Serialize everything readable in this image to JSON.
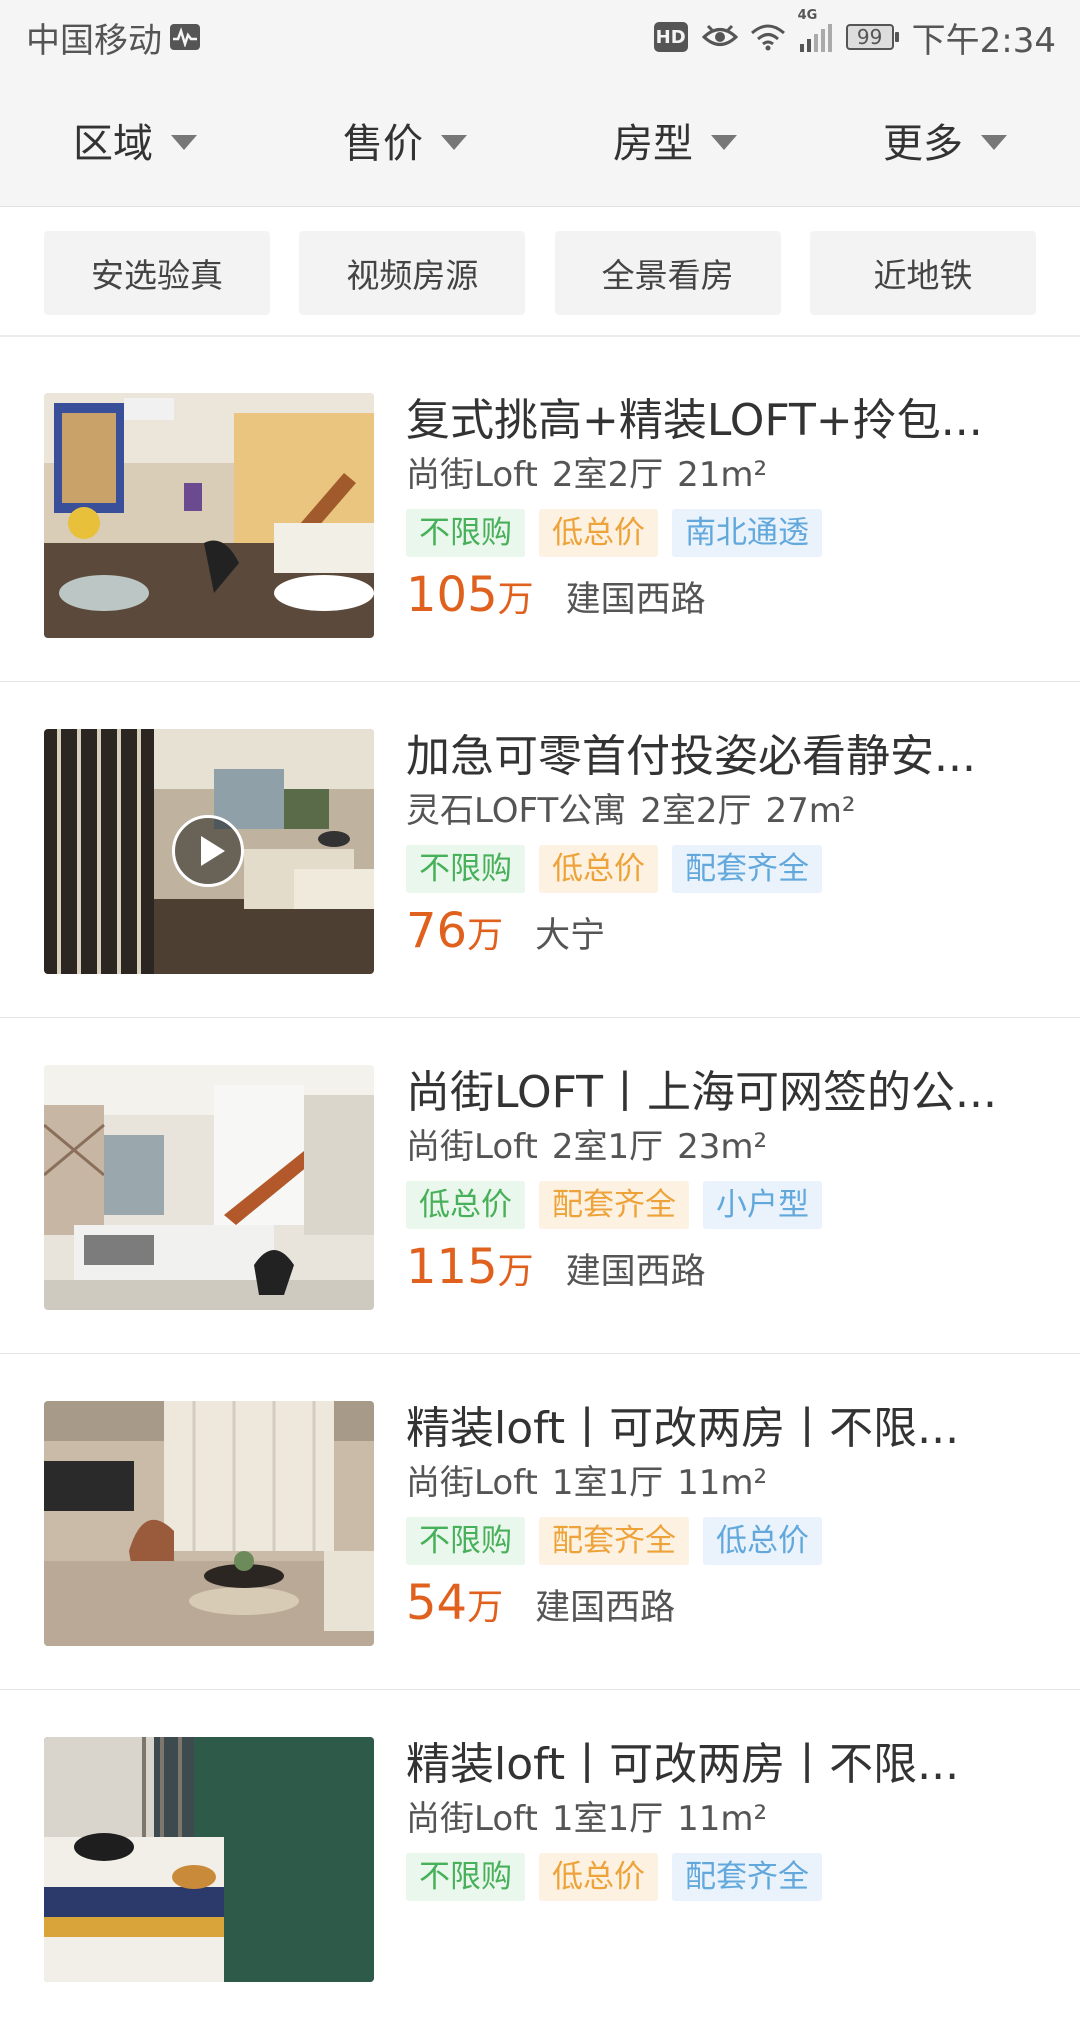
{
  "status_bar": {
    "carrier": "中国移动",
    "hd": "HD",
    "network": "4G",
    "battery": "99",
    "time": "下午2:34"
  },
  "filters": [
    {
      "label": "区域"
    },
    {
      "label": "售价"
    },
    {
      "label": "房型"
    },
    {
      "label": "更多"
    }
  ],
  "quick_tags": [
    {
      "label": "安选验真"
    },
    {
      "label": "视频房源"
    },
    {
      "label": "全景看房"
    },
    {
      "label": "近地铁"
    }
  ],
  "listings": [
    {
      "title": "复式挑高+精装LOFT+拎包...",
      "community": "尚街Loft",
      "layout": "2室2厅",
      "size": "21m²",
      "tags": [
        {
          "text": "不限购",
          "color": "green"
        },
        {
          "text": "低总价",
          "color": "orange"
        },
        {
          "text": "南北通透",
          "color": "blue"
        }
      ],
      "price": "105",
      "price_unit": "万",
      "area": "建国西路",
      "has_video": false
    },
    {
      "title": "加急可零首付投姿必看静安...",
      "community": "灵石LOFT公寓",
      "layout": "2室2厅",
      "size": "27m²",
      "tags": [
        {
          "text": "不限购",
          "color": "green"
        },
        {
          "text": "低总价",
          "color": "orange"
        },
        {
          "text": "配套齐全",
          "color": "blue"
        }
      ],
      "price": "76",
      "price_unit": "万",
      "area": "大宁",
      "has_video": true
    },
    {
      "title": "尚街LOFT丨上海可网签的公...",
      "community": "尚街Loft",
      "layout": "2室1厅",
      "size": "23m²",
      "tags": [
        {
          "text": "低总价",
          "color": "green"
        },
        {
          "text": "配套齐全",
          "color": "orange"
        },
        {
          "text": "小户型",
          "color": "blue"
        }
      ],
      "price": "115",
      "price_unit": "万",
      "area": "建国西路",
      "has_video": false
    },
    {
      "title": "精装loft丨可改两房丨不限...",
      "community": "尚街Loft",
      "layout": "1室1厅",
      "size": "11m²",
      "tags": [
        {
          "text": "不限购",
          "color": "green"
        },
        {
          "text": "配套齐全",
          "color": "orange"
        },
        {
          "text": "低总价",
          "color": "blue"
        }
      ],
      "price": "54",
      "price_unit": "万",
      "area": "建国西路",
      "has_video": false
    },
    {
      "title": "精装loft丨可改两房丨不限...",
      "community": "尚街Loft",
      "layout": "1室1厅",
      "size": "11m²",
      "tags": [
        {
          "text": "不限购",
          "color": "green"
        },
        {
          "text": "低总价",
          "color": "orange"
        },
        {
          "text": "配套齐全",
          "color": "blue"
        }
      ],
      "price": "",
      "price_unit": "",
      "area": "",
      "has_video": false
    }
  ]
}
